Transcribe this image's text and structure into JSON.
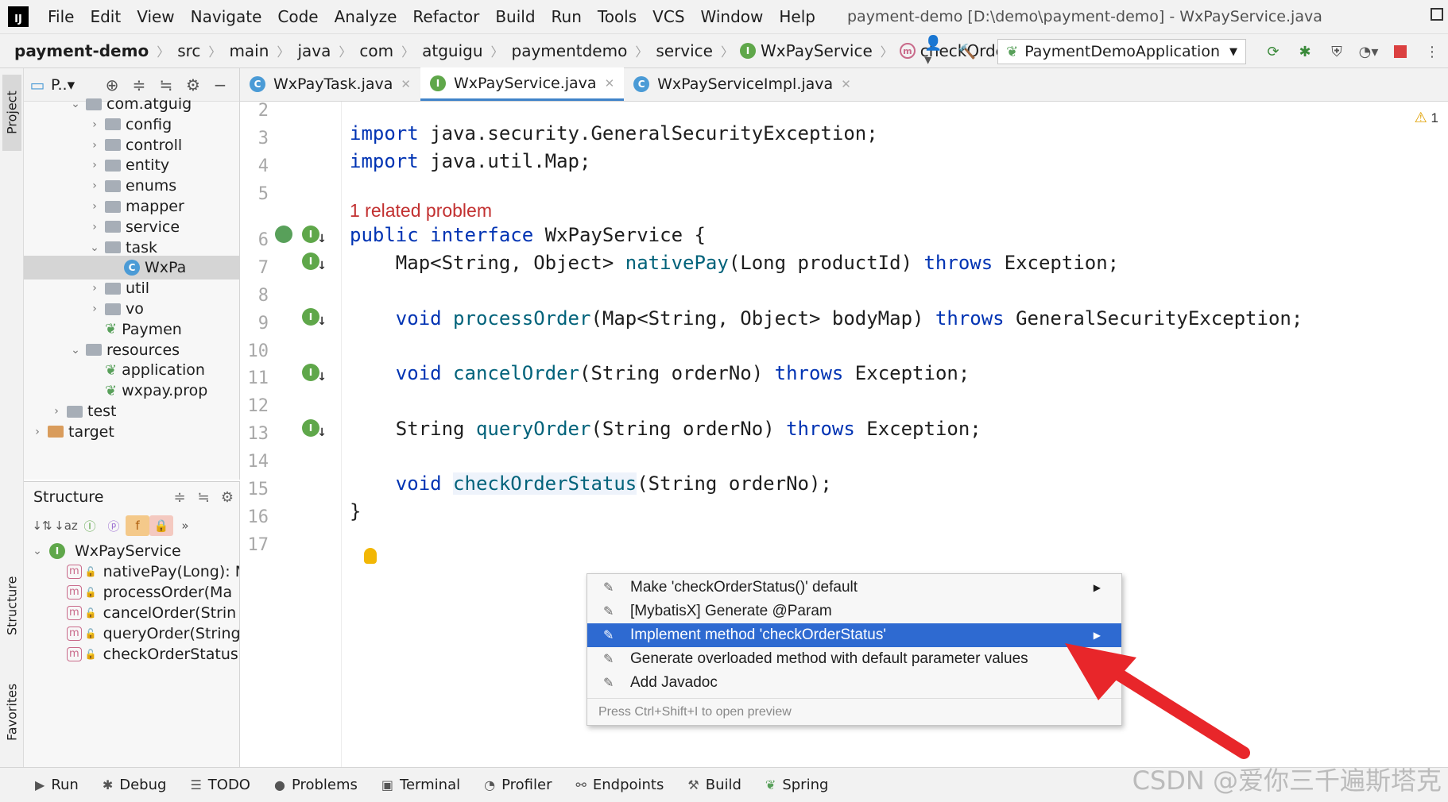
{
  "menubar": {
    "items": [
      "File",
      "Edit",
      "View",
      "Navigate",
      "Code",
      "Analyze",
      "Refactor",
      "Build",
      "Run",
      "Tools",
      "VCS",
      "Window",
      "Help"
    ],
    "title": "payment-demo [D:\\demo\\payment-demo] - WxPayService.java"
  },
  "breadcrumb": [
    "payment-demo",
    "src",
    "main",
    "java",
    "com",
    "atguigu",
    "paymentdemo",
    "service",
    "WxPayService",
    "checkOrderStatus"
  ],
  "run_config": "PaymentDemoApplication",
  "project_panel": {
    "title": "P..▾",
    "tree": [
      {
        "label": "com.atguig",
        "indent": 1,
        "arrow": "⌄",
        "icon": "folder"
      },
      {
        "label": "config",
        "indent": 2,
        "arrow": "›",
        "icon": "folder"
      },
      {
        "label": "controll",
        "indent": 2,
        "arrow": "›",
        "icon": "folder"
      },
      {
        "label": "entity",
        "indent": 2,
        "arrow": "›",
        "icon": "folder"
      },
      {
        "label": "enums",
        "indent": 2,
        "arrow": "›",
        "icon": "folder"
      },
      {
        "label": "mapper",
        "indent": 2,
        "arrow": "›",
        "icon": "folder"
      },
      {
        "label": "service",
        "indent": 2,
        "arrow": "›",
        "icon": "folder"
      },
      {
        "label": "task",
        "indent": 2,
        "arrow": "⌄",
        "icon": "folder"
      },
      {
        "label": "WxPa",
        "indent": 3,
        "arrow": "",
        "icon": "class",
        "selected": true
      },
      {
        "label": "util",
        "indent": 2,
        "arrow": "›",
        "icon": "folder"
      },
      {
        "label": "vo",
        "indent": 2,
        "arrow": "›",
        "icon": "folder"
      },
      {
        "label": "Paymen",
        "indent": 2,
        "arrow": "",
        "icon": "spring"
      },
      {
        "label": "resources",
        "indent": 1,
        "arrow": "⌄",
        "icon": "folder"
      },
      {
        "label": "application",
        "indent": 2,
        "arrow": "",
        "icon": "spring"
      },
      {
        "label": "wxpay.prop",
        "indent": 2,
        "arrow": "",
        "icon": "spring"
      },
      {
        "label": "test",
        "indent": 0,
        "arrow": "›",
        "icon": "folder"
      },
      {
        "label": "target",
        "indent": -1,
        "arrow": "›",
        "icon": "folder-orange"
      }
    ]
  },
  "structure_panel": {
    "title": "Structure",
    "root": "WxPayService",
    "items": [
      "nativePay(Long): M",
      "processOrder(Ma",
      "cancelOrder(Strin",
      "queryOrder(String",
      "checkOrderStatus"
    ]
  },
  "left_strip": {
    "project": "Project",
    "structure": "Structure",
    "favorites": "Favorites"
  },
  "tabs": [
    {
      "label": "WxPayTask.java",
      "type": "C",
      "active": false
    },
    {
      "label": "WxPayService.java",
      "type": "I",
      "active": true
    },
    {
      "label": "WxPayServiceImpl.java",
      "type": "C",
      "active": false
    }
  ],
  "editor": {
    "warning_count": "1",
    "problem_hint": "1 related problem",
    "line_numbers": [
      "2",
      "3",
      "4",
      "5",
      "6",
      "7",
      "8",
      "9",
      "10",
      "11",
      "12",
      "13",
      "14",
      "15",
      "16",
      "17"
    ]
  },
  "code_lines": {
    "l3_kw": "import",
    "l3_rest": " java.security.GeneralSecurityException;",
    "l4_kw": "import",
    "l4_rest": " java.util.Map;",
    "l6_kw": "public interface",
    "l6_rest": " WxPayService {",
    "l7_a": "    Map<String, Object> ",
    "l7_fn": "nativePay",
    "l7_b": "(Long productId) ",
    "l7_kw": "throws",
    "l7_c": " Exception;",
    "l9_kw": "    void ",
    "l9_fn": "processOrder",
    "l9_b": "(Map<String, Object> bodyMap) ",
    "l9_kw2": "throws",
    "l9_c": " GeneralSecurityException;",
    "l11_kw": "    void ",
    "l11_fn": "cancelOrder",
    "l11_b": "(String orderNo) ",
    "l11_kw2": "throws",
    "l11_c": " Exception;",
    "l13_a": "    String ",
    "l13_fn": "queryOrder",
    "l13_b": "(String orderNo) ",
    "l13_kw": "throws",
    "l13_c": " Exception;",
    "l15_kw": "    void ",
    "l15_fn": "checkOrderStatus",
    "l15_b": "(String orderNo);",
    "l16": "}"
  },
  "popup": {
    "items": [
      {
        "label": "Make 'checkOrderStatus()' default",
        "submenu": true,
        "selected": false
      },
      {
        "label": "[MybatisX] Generate @Param",
        "submenu": false,
        "selected": false
      },
      {
        "label": "Implement method 'checkOrderStatus'",
        "submenu": true,
        "selected": true
      },
      {
        "label": "Generate overloaded method with default parameter values",
        "submenu": false,
        "selected": false
      },
      {
        "label": "Add Javadoc",
        "submenu": false,
        "selected": false
      }
    ],
    "footer": "Press Ctrl+Shift+I to open preview"
  },
  "bottom_bar": [
    "Run",
    "Debug",
    "TODO",
    "Problems",
    "Terminal",
    "Profiler",
    "Endpoints",
    "Build",
    "Spring"
  ],
  "watermark": "CSDN @爱你三千遍斯塔克",
  "colors": {
    "accent": "#2e6ad1",
    "keyword": "#0033b3",
    "method": "#00627a",
    "problem": "#c23030",
    "arrow": "#e8262a"
  }
}
